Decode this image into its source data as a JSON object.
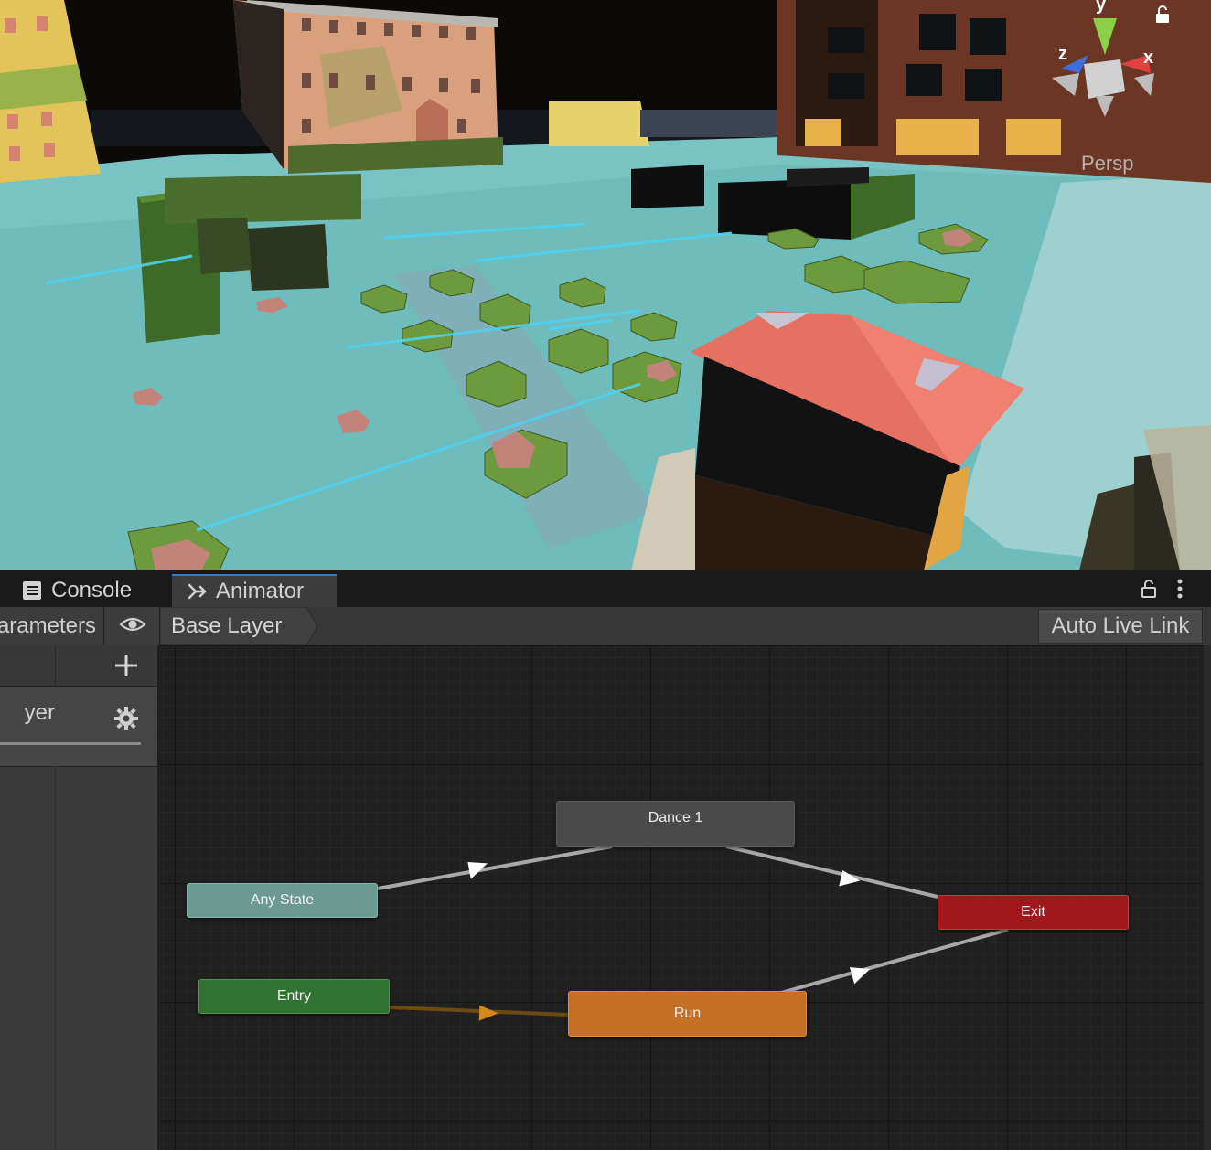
{
  "scene": {
    "projection_label": "Persp",
    "gizmo": {
      "y_axis": "y",
      "x_axis": "x",
      "z_axis": "z"
    }
  },
  "tabs": [
    {
      "label": "Console",
      "icon": "console-icon",
      "active": false
    },
    {
      "label": "Animator",
      "icon": "animator-icon",
      "active": true
    }
  ],
  "toolbar": {
    "parameters_label": "arameters",
    "breadcrumb": "Base Layer",
    "auto_live_link": "Auto Live Link"
  },
  "layers": {
    "items": [
      {
        "name": "yer"
      }
    ]
  },
  "graph": {
    "states": {
      "dance": "Dance 1",
      "any_state": "Any State",
      "exit": "Exit",
      "entry": "Entry",
      "run": "Run"
    }
  },
  "colors": {
    "any_state": "#6b9a92",
    "entry": "#2f7232",
    "exit": "#a1171b",
    "default_state": "#c56f22",
    "normal_state": "#4a4a4a",
    "tab_accent": "#3a79bb"
  }
}
